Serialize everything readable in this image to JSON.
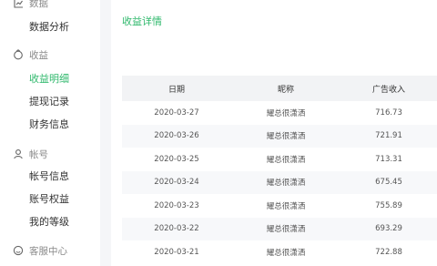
{
  "sidebar": {
    "sections": [
      {
        "label": "数据",
        "icon": "chart-icon",
        "items": [
          {
            "label": "数据分析"
          }
        ]
      },
      {
        "label": "收益",
        "icon": "wallet-icon",
        "items": [
          {
            "label": "收益明细",
            "active": true
          },
          {
            "label": "提现记录"
          },
          {
            "label": "财务信息"
          }
        ]
      },
      {
        "label": "帐号",
        "icon": "user-icon",
        "items": [
          {
            "label": "帐号信息"
          },
          {
            "label": "账号权益"
          },
          {
            "label": "我的等级"
          }
        ]
      },
      {
        "label": "客服中心",
        "icon": "service-icon",
        "items": []
      }
    ]
  },
  "main": {
    "title": "收益详情",
    "table": {
      "headers": [
        "日期",
        "昵称",
        "广告收入"
      ],
      "rows": [
        [
          "2020-03-27",
          "耀总很潇洒",
          "716.73"
        ],
        [
          "2020-03-26",
          "耀总很潇洒",
          "721.91"
        ],
        [
          "2020-03-25",
          "耀总很潇洒",
          "713.31"
        ],
        [
          "2020-03-24",
          "耀总很潇洒",
          "675.45"
        ],
        [
          "2020-03-23",
          "耀总很潇洒",
          "755.89"
        ],
        [
          "2020-03-22",
          "耀总很潇洒",
          "693.29"
        ],
        [
          "2020-03-21",
          "耀总很潇洒",
          "722.88"
        ]
      ]
    }
  },
  "colors": {
    "accent": "#2fb86c"
  }
}
